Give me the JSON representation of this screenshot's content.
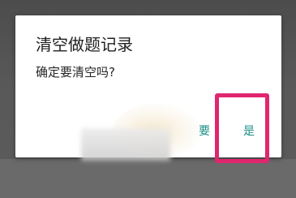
{
  "dialog": {
    "title": "清空做题记录",
    "message": "确定要清空吗?",
    "negative_label": "要",
    "positive_label": "是"
  },
  "colors": {
    "button_text": "#1b8e86",
    "highlight": "#e0266e",
    "scrim": "#5d5d5d",
    "dialog_bg": "#ffffff"
  }
}
